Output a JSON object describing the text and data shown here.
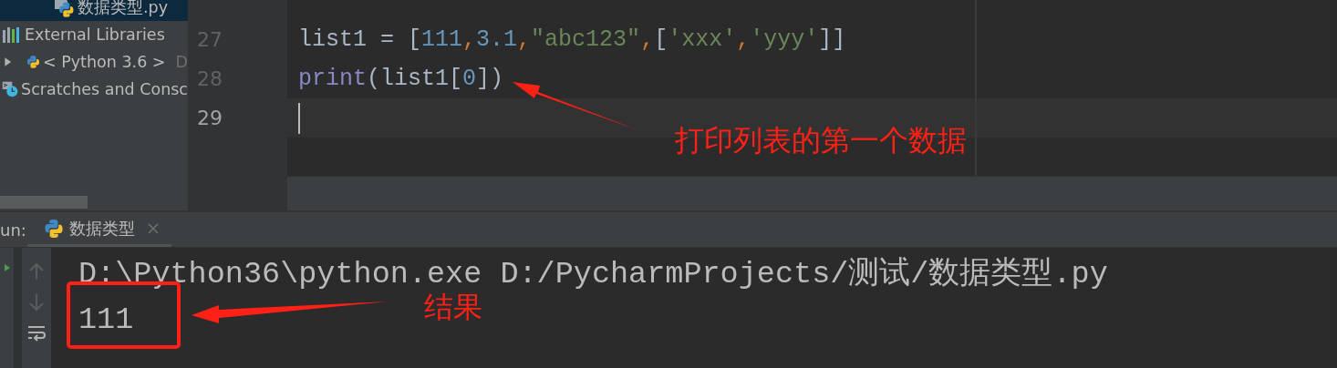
{
  "project_tree": {
    "items": [
      {
        "label": "数据类型.py",
        "kind": "python-file",
        "selected": true
      },
      {
        "label": "External Libraries",
        "kind": "libraries",
        "selected": false,
        "children": [
          {
            "label": "< Python 3.6 >",
            "detail": "D",
            "kind": "interpreter",
            "selected": false,
            "expanded": false
          }
        ]
      },
      {
        "label": "Scratches and Consc",
        "kind": "scratches",
        "selected": false
      }
    ]
  },
  "editor": {
    "lines": [
      {
        "number": "27",
        "current": false,
        "tokens": [
          {
            "text": "list1 = [",
            "kind": "plain"
          },
          {
            "text": "111",
            "kind": "number"
          },
          {
            "text": ",",
            "kind": "comma"
          },
          {
            "text": "3.1",
            "kind": "number"
          },
          {
            "text": ",",
            "kind": "comma"
          },
          {
            "text": "\"abc123\"",
            "kind": "string"
          },
          {
            "text": ",",
            "kind": "comma"
          },
          {
            "text": "[",
            "kind": "plain"
          },
          {
            "text": "'xxx'",
            "kind": "string"
          },
          {
            "text": ",",
            "kind": "comma"
          },
          {
            "text": "'yyy'",
            "kind": "string"
          },
          {
            "text": "]]",
            "kind": "plain"
          }
        ]
      },
      {
        "number": "28",
        "current": false,
        "tokens": [
          {
            "text": "print",
            "kind": "builtin"
          },
          {
            "text": "(list1[",
            "kind": "plain"
          },
          {
            "text": "0",
            "kind": "number"
          },
          {
            "text": "])",
            "kind": "plain"
          }
        ]
      },
      {
        "number": "29",
        "current": true
      }
    ]
  },
  "run_panel": {
    "label": "un:",
    "tabs": [
      {
        "label": "数据类型",
        "selected": true
      }
    ],
    "console": [
      "D:\\Python36\\python.exe D:/PycharmProjects/测试/数据类型.py",
      "111"
    ]
  },
  "annotations": [
    {
      "text": "打印列表的第一个数据",
      "kind": "arrow-note"
    },
    {
      "text": "结果",
      "kind": "boxed-note"
    }
  ]
}
